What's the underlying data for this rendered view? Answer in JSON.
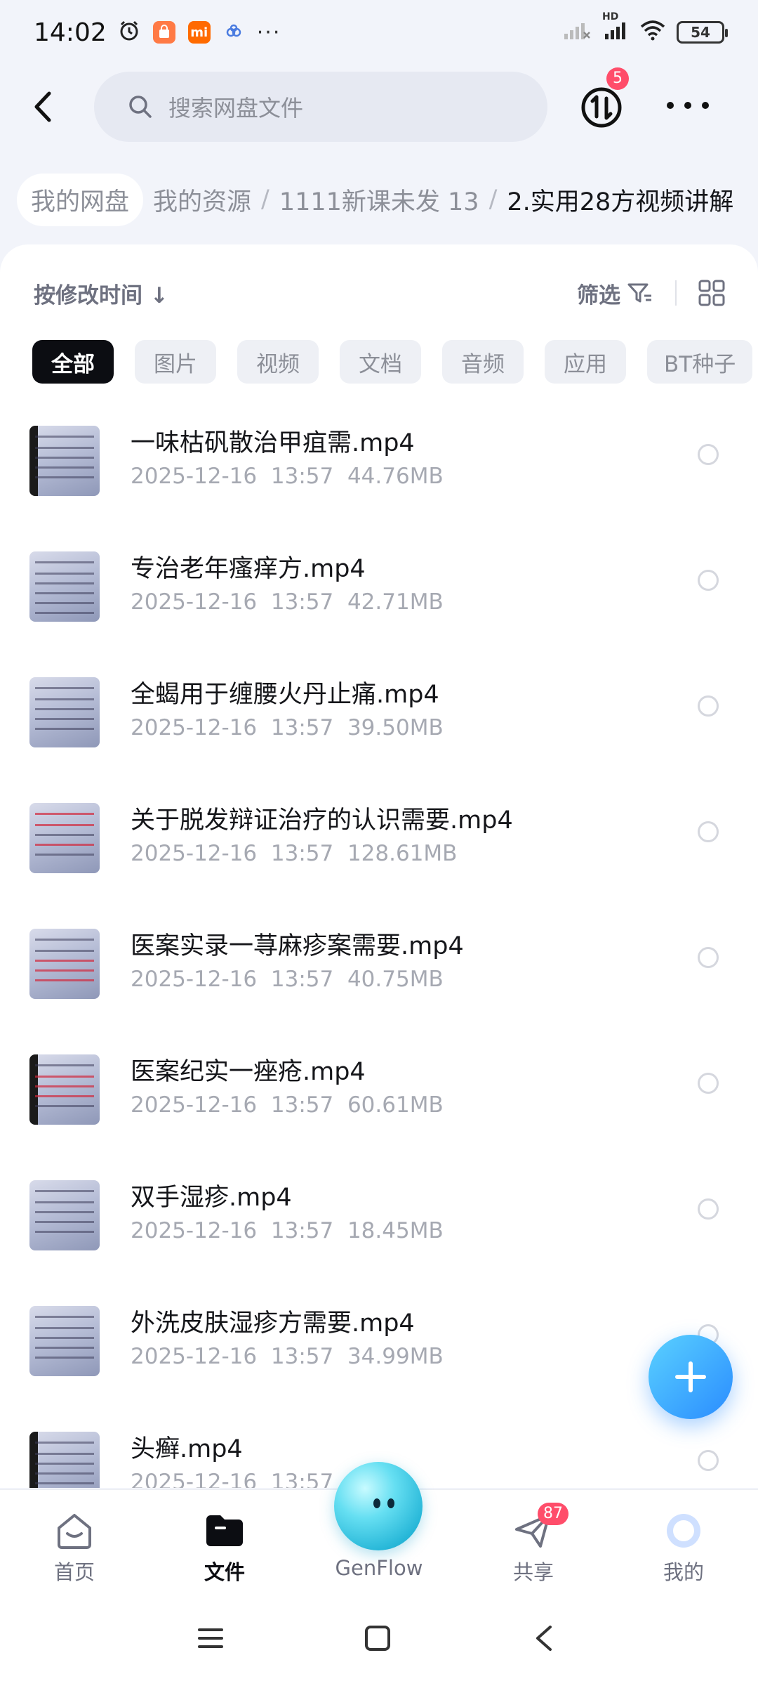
{
  "status_bar": {
    "time": "14:02",
    "battery": "54",
    "network_label": "HD"
  },
  "header": {
    "search_placeholder": "搜索网盘文件",
    "transfer_badge": "5"
  },
  "breadcrumb": {
    "items": [
      "我的网盘",
      "我的资源",
      "1111新课未发 13"
    ],
    "current": "2.实用28方视频讲解"
  },
  "toolbar": {
    "sort_label": "按修改时间 ↓",
    "filter_label": "筛选"
  },
  "chips": [
    "全部",
    "图片",
    "视频",
    "文档",
    "音频",
    "应用",
    "BT种子"
  ],
  "files": [
    {
      "name": "一味枯矾散治甲疽需.mp4",
      "date": "2025-12-16",
      "time": "13:57",
      "size": "44.76MB"
    },
    {
      "name": "专治老年瘙痒方.mp4",
      "date": "2025-12-16",
      "time": "13:57",
      "size": "42.71MB"
    },
    {
      "name": "全蝎用于缠腰火丹止痛.mp4",
      "date": "2025-12-16",
      "time": "13:57",
      "size": "39.50MB"
    },
    {
      "name": "关于脱发辩证治疗的认识需要.mp4",
      "date": "2025-12-16",
      "time": "13:57",
      "size": "128.61MB"
    },
    {
      "name": "医案实录一荨麻疹案需要.mp4",
      "date": "2025-12-16",
      "time": "13:57",
      "size": "40.75MB"
    },
    {
      "name": "医案纪实一痤疮.mp4",
      "date": "2025-12-16",
      "time": "13:57",
      "size": "60.61MB"
    },
    {
      "name": "双手湿疹.mp4",
      "date": "2025-12-16",
      "time": "13:57",
      "size": "18.45MB"
    },
    {
      "name": "外洗皮肤湿疹方需要.mp4",
      "date": "2025-12-16",
      "time": "13:57",
      "size": "34.99MB"
    },
    {
      "name": "头癣.mp4",
      "date": "2025-12-16",
      "time": "13:57",
      "size": ""
    }
  ],
  "bottom_nav": {
    "home": "首页",
    "files": "文件",
    "genflow": "GenFlow",
    "share": "共享",
    "share_badge": "87",
    "me": "我的"
  }
}
